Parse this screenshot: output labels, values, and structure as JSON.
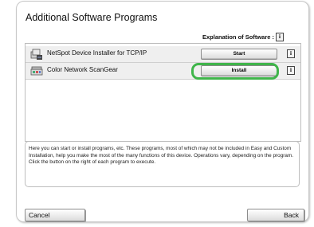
{
  "dialog": {
    "title": "Additional Software Programs",
    "explanation_label": "Explanation of Software :",
    "info_glyph": "i"
  },
  "programs": [
    {
      "name": "NetSpot Device Installer for TCP/IP",
      "action_label": "Start",
      "icon": "network-installer-icon"
    },
    {
      "name": "Color Network ScanGear",
      "action_label": "Install",
      "icon": "scanner-icon",
      "highlighted": true
    }
  ],
  "description": "Here you can start or install programs, etc. These programs, most of which may not be included in Easy and Custom Installation, help you make the most of the many functions of this device. Operations vary, depending on the program. Click the button on the right of each program to execute.",
  "footer": {
    "cancel_label": "Cancel",
    "back_label": "Back"
  },
  "colors": {
    "highlight": "#3fb54a",
    "row_background": "#efefef"
  }
}
